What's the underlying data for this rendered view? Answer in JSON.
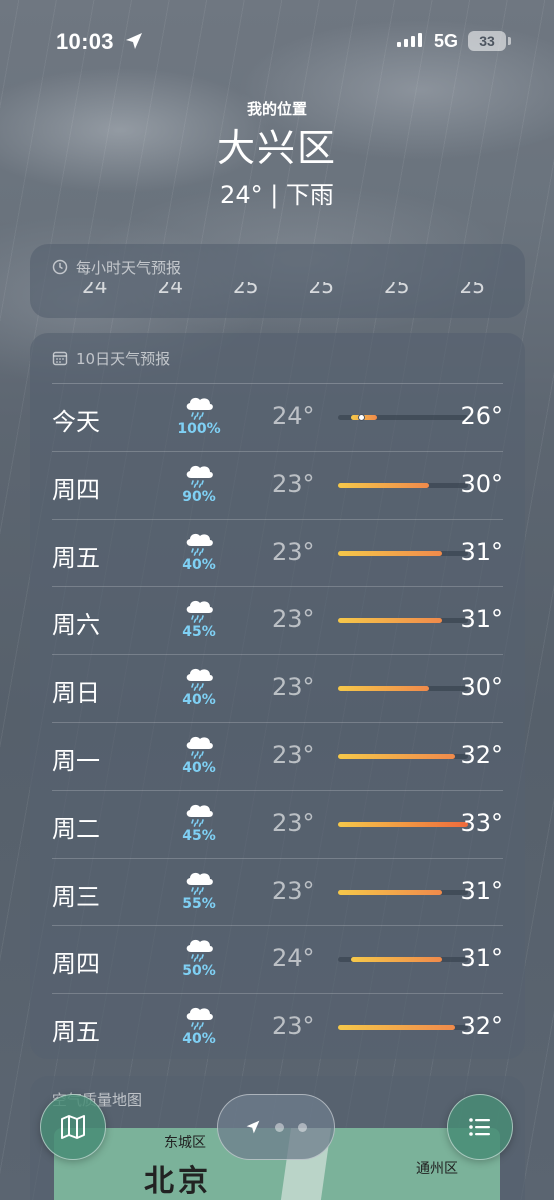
{
  "status_bar": {
    "time": "10:03",
    "network": "5G",
    "battery": "33"
  },
  "header": {
    "label": "我的位置",
    "city": "大兴区",
    "summary": "24° | 下雨"
  },
  "hourly": {
    "title": "每小时天气预报",
    "temps": [
      "24",
      "24",
      "25",
      "25",
      "25",
      "25"
    ]
  },
  "daily": {
    "title": "10日天气预报",
    "scale": {
      "min": 23,
      "max": 33
    },
    "days": [
      {
        "day": "今天",
        "precip": "100%",
        "low": "24°",
        "high": "26°",
        "low_v": 24,
        "high_v": 26,
        "current_v": 24,
        "current_dot": true
      },
      {
        "day": "周四",
        "precip": "90%",
        "low": "23°",
        "high": "30°",
        "low_v": 23,
        "high_v": 30
      },
      {
        "day": "周五",
        "precip": "40%",
        "low": "23°",
        "high": "31°",
        "low_v": 23,
        "high_v": 31
      },
      {
        "day": "周六",
        "precip": "45%",
        "low": "23°",
        "high": "31°",
        "low_v": 23,
        "high_v": 31
      },
      {
        "day": "周日",
        "precip": "40%",
        "low": "23°",
        "high": "30°",
        "low_v": 23,
        "high_v": 30
      },
      {
        "day": "周一",
        "precip": "40%",
        "low": "23°",
        "high": "32°",
        "low_v": 23,
        "high_v": 32
      },
      {
        "day": "周二",
        "precip": "45%",
        "low": "23°",
        "high": "33°",
        "low_v": 23,
        "high_v": 33
      },
      {
        "day": "周三",
        "precip": "55%",
        "low": "23°",
        "high": "31°",
        "low_v": 23,
        "high_v": 31
      },
      {
        "day": "周四",
        "precip": "50%",
        "low": "24°",
        "high": "31°",
        "low_v": 24,
        "high_v": 31
      },
      {
        "day": "周五",
        "precip": "40%",
        "low": "23°",
        "high": "32°",
        "low_v": 23,
        "high_v": 32
      }
    ]
  },
  "air_quality": {
    "title": "空气质量地图",
    "map_labels": {
      "district": "东城区",
      "city": "北京",
      "east": "通州区"
    }
  },
  "colors": {
    "precip": "#7fd0f4",
    "bar_start": "#f6c84a",
    "bar_end": "#f08a4b",
    "fab": "#488c76"
  },
  "icons": [
    "location-arrow-icon",
    "clock-icon",
    "calendar-icon",
    "rain-cloud-icon",
    "map-icon",
    "list-icon"
  ]
}
